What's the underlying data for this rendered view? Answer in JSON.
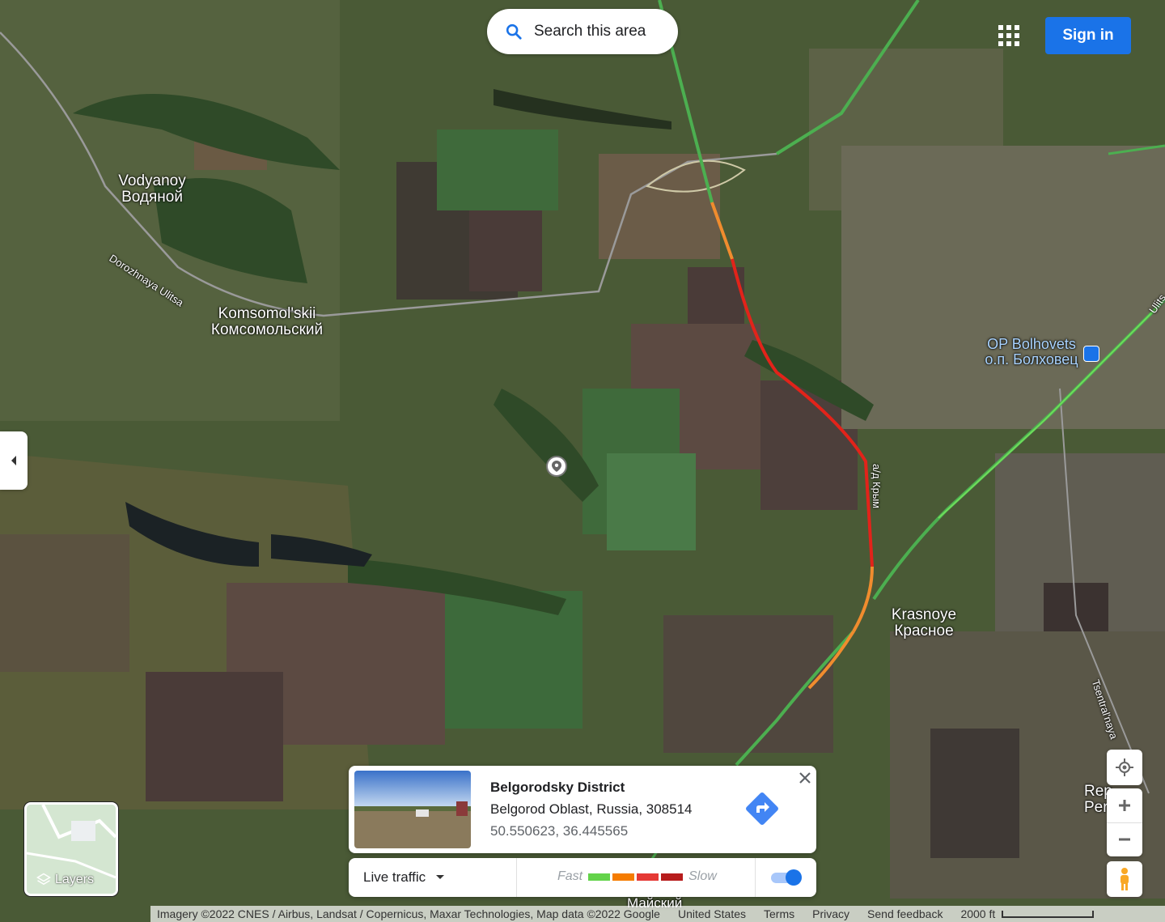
{
  "search": {
    "label": "Search this area"
  },
  "header": {
    "sign_in": "Sign in",
    "apps_icon": "apps-grid-icon"
  },
  "map": {
    "type": "satellite",
    "labels": {
      "vodyanoy_latin": "Vodyanoy",
      "vodyanoy_cyrillic": "Водяной",
      "dorozhnaya": "Dorozhnaya Ulitsa",
      "komsomolskii_latin": "Komsomol'skii",
      "komsomolskii_cyrillic": "Комсомольский",
      "bolhovets_latin": "OP Bolhovets",
      "bolhovets_cyrillic": "о.п. Болховец",
      "krasnoye_latin": "Krasnoye",
      "krasnoye_cyrillic": "Красное",
      "ad_krym": "а/д Крым",
      "tsentralnaya": "Tsentral'naya",
      "ulitsa_edge": "Ulits",
      "rep_edge": "Rep",
      "per_edge": "Per",
      "mayskiy_edge": "Майский"
    },
    "traffic_colors": {
      "fast": "#4caf50",
      "moderate": "#f08c2e",
      "slow": "#e2231a",
      "very_slow": "#a51c1c"
    }
  },
  "place_card": {
    "title": "Belgorodsky District",
    "address": "Belgorod Oblast, Russia, 308514",
    "coordinates": "50.550623, 36.445565"
  },
  "traffic_bar": {
    "selector_label": "Live traffic",
    "fast_label": "Fast",
    "slow_label": "Slow",
    "enabled": true,
    "legend_colors": [
      "#63d34a",
      "#f57c00",
      "#e53935",
      "#b71c1c"
    ]
  },
  "layers": {
    "label": "Layers"
  },
  "footer": {
    "attribution": "Imagery ©2022 CNES / Airbus, Landsat / Copernicus, Maxar Technologies, Map data ©2022 Google",
    "country": "United States",
    "terms": "Terms",
    "privacy": "Privacy",
    "feedback": "Send feedback",
    "scale": "2000 ft"
  },
  "accent": "#1a73e8"
}
